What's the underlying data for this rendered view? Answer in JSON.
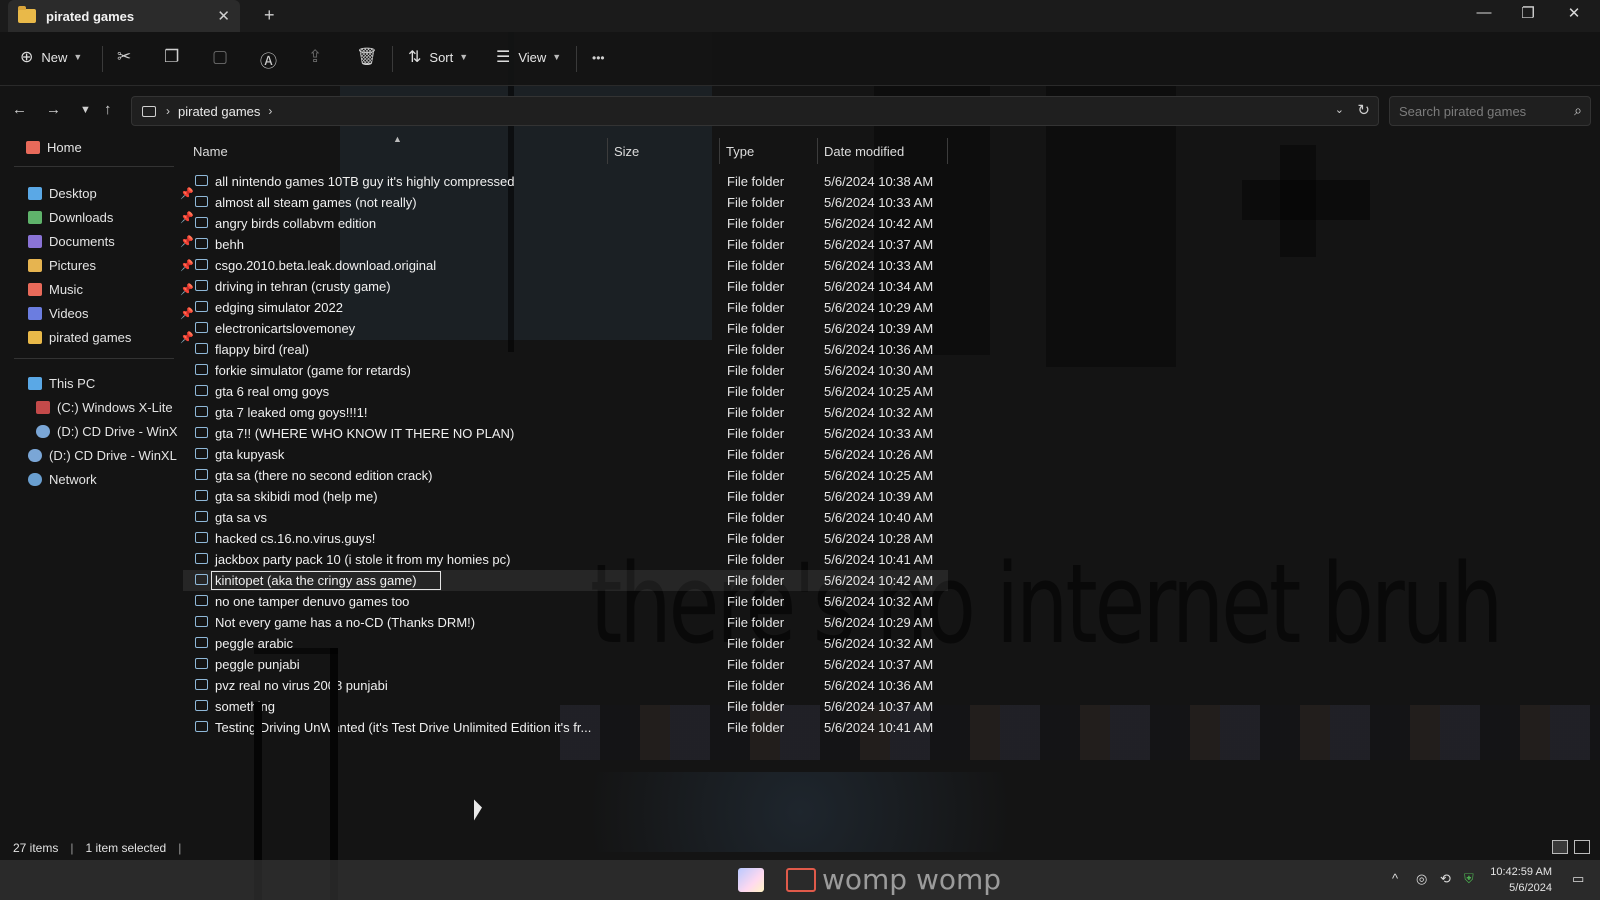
{
  "window": {
    "tab_title": "pirated games",
    "close_glyph": "✕",
    "new_tab_glyph": "+",
    "min_glyph": "—",
    "max_glyph": "❐",
    "winclose_glyph": "✕"
  },
  "toolbar": {
    "new_label": "New",
    "sort_label": "Sort",
    "view_label": "View",
    "more_glyph": "•••"
  },
  "address": {
    "path": "pirated games",
    "search_placeholder": "Search pirated games"
  },
  "sidebar": {
    "home": "Home",
    "quick": [
      {
        "label": "Desktop",
        "color": "#5aa8e6"
      },
      {
        "label": "Downloads",
        "color": "#5fb36b"
      },
      {
        "label": "Documents",
        "color": "#8a73d6"
      },
      {
        "label": "Pictures",
        "color": "#e6b450"
      },
      {
        "label": "Music",
        "color": "#e86a5a"
      },
      {
        "label": "Videos",
        "color": "#6b7de0"
      },
      {
        "label": "pirated games",
        "color": "#e9b949"
      }
    ],
    "this_pc": "This PC",
    "drives": [
      "(C:) Windows X-Lite",
      "(D:) CD Drive - WinX",
      "(D:) CD Drive - WinXL"
    ],
    "network": "Network"
  },
  "columns": {
    "name": "Name",
    "size": "Size",
    "type": "Type",
    "date": "Date modified"
  },
  "files": [
    {
      "name": "all nintendo games 10TB guy it's highly compressed",
      "type": "File folder",
      "date": "5/6/2024 10:38 AM"
    },
    {
      "name": "almost all steam games (not really)",
      "type": "File folder",
      "date": "5/6/2024 10:33 AM"
    },
    {
      "name": "angry birds collabvm edition",
      "type": "File folder",
      "date": "5/6/2024 10:42 AM"
    },
    {
      "name": "behh",
      "type": "File folder",
      "date": "5/6/2024 10:37 AM"
    },
    {
      "name": "csgo.2010.beta.leak.download.original",
      "type": "File folder",
      "date": "5/6/2024 10:33 AM"
    },
    {
      "name": "driving in tehran (crusty game)",
      "type": "File folder",
      "date": "5/6/2024 10:34 AM"
    },
    {
      "name": "edging simulator 2022",
      "type": "File folder",
      "date": "5/6/2024 10:29 AM"
    },
    {
      "name": "electronicartslovemoney",
      "type": "File folder",
      "date": "5/6/2024 10:39 AM"
    },
    {
      "name": "flappy bird (real)",
      "type": "File folder",
      "date": "5/6/2024 10:36 AM"
    },
    {
      "name": "forkie simulator (game for retards)",
      "type": "File folder",
      "date": "5/6/2024 10:30 AM"
    },
    {
      "name": "gta 6 real omg goys",
      "type": "File folder",
      "date": "5/6/2024 10:25 AM"
    },
    {
      "name": "gta 7 leaked omg goys!!!1!",
      "type": "File folder",
      "date": "5/6/2024 10:32 AM"
    },
    {
      "name": "gta 7!! (WHERE WHO KNOW IT THERE NO PLAN)",
      "type": "File folder",
      "date": "5/6/2024 10:33 AM"
    },
    {
      "name": "gta kupyask",
      "type": "File folder",
      "date": "5/6/2024 10:26 AM"
    },
    {
      "name": "gta sa (there no second edition crack)",
      "type": "File folder",
      "date": "5/6/2024 10:25 AM"
    },
    {
      "name": "gta sa skibidi mod (help me)",
      "type": "File folder",
      "date": "5/6/2024 10:39 AM"
    },
    {
      "name": "gta sa vs",
      "type": "File folder",
      "date": "5/6/2024 10:40 AM"
    },
    {
      "name": "hacked cs.16.no.virus.guys!",
      "type": "File folder",
      "date": "5/6/2024 10:28 AM"
    },
    {
      "name": "jackbox party pack 10 (i stole it from my homies pc)",
      "type": "File folder",
      "date": "5/6/2024 10:41 AM"
    },
    {
      "name": "kinitopet (aka the cringy ass game)",
      "type": "File folder",
      "date": "5/6/2024 10:42 AM"
    },
    {
      "name": "no one tamper denuvo games too",
      "type": "File folder",
      "date": "5/6/2024 10:32 AM"
    },
    {
      "name": "Not every game has a no-CD (Thanks DRM!)",
      "type": "File folder",
      "date": "5/6/2024 10:29 AM"
    },
    {
      "name": "peggle arabic",
      "type": "File folder",
      "date": "5/6/2024 10:32 AM"
    },
    {
      "name": "peggle punjabi",
      "type": "File folder",
      "date": "5/6/2024 10:37 AM"
    },
    {
      "name": "pvz real no virus 2008 punjabi",
      "type": "File folder",
      "date": "5/6/2024 10:36 AM"
    },
    {
      "name": "something",
      "type": "File folder",
      "date": "5/6/2024 10:37 AM"
    },
    {
      "name": "Testing Driving UnWanted (it's Test Drive Unlimited Edition it's fr...",
      "type": "File folder",
      "date": "5/6/2024 10:41 AM"
    }
  ],
  "selected_name": "kinitopet (aka the cringy ass game)",
  "status": {
    "count": "27 items",
    "selection": "1 item selected"
  },
  "taskbar": {
    "label": "womp womp",
    "time": "10:42:59 AM",
    "date": "5/6/2024"
  },
  "background": {
    "overlay_text": "there's no internet bruh"
  },
  "icons": {
    "new": "plus-circle-icon",
    "cut": "scissors-icon",
    "copy": "copy-icon",
    "paste": "clipboard-icon",
    "rename": "rename-icon",
    "share": "share-icon",
    "delete": "trash-icon",
    "sort": "sort-icon",
    "view": "view-list-icon",
    "more": "more-icon"
  }
}
